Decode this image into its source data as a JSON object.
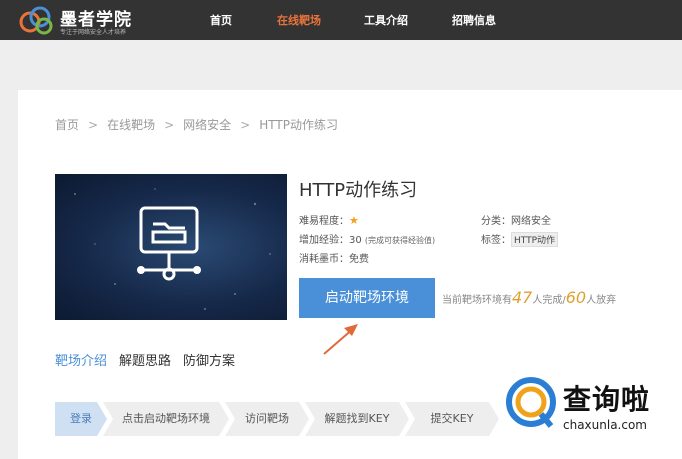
{
  "logo": {
    "name": "墨者学院",
    "tagline": "专注于网络安全人才培养"
  },
  "nav": [
    {
      "label": "首页",
      "active": false
    },
    {
      "label": "在线靶场",
      "active": true
    },
    {
      "label": "工具介绍",
      "active": false
    },
    {
      "label": "招聘信息",
      "active": false
    }
  ],
  "breadcrumb": [
    "首页",
    "在线靶场",
    "网络安全",
    "HTTP动作练习"
  ],
  "breadcrumb_sep": ">",
  "title": "HTTP动作练习",
  "info": {
    "difficulty_label": "难易程度：",
    "difficulty_stars": 1,
    "exp_label": "增加经验：30",
    "exp_note": "(完成可获得经验值)",
    "cost_label": "消耗墨币：免费",
    "category_label": "分类：网络安全",
    "tags_label": "标签：",
    "tag": "HTTP动作"
  },
  "start_button": "启动靶场环境",
  "stats": {
    "prefix": "当前靶场环境有",
    "completed": "47",
    "completed_suffix": "人完成/",
    "abandoned": "60",
    "abandoned_suffix": "人放弃"
  },
  "tabs": [
    {
      "label": "靶场介绍",
      "active": true
    },
    {
      "label": "解题思路",
      "active": false
    },
    {
      "label": "防御方案",
      "active": false
    }
  ],
  "steps": [
    "登录",
    "点击启动靶场环境",
    "访问靶场",
    "解题找到KEY",
    "提交KEY"
  ],
  "watermark": {
    "text": "查询啦",
    "url": "chaxunla.com"
  },
  "colors": {
    "accent": "#4a90d9",
    "nav_active": "#e8743b",
    "topbar": "#333333"
  }
}
